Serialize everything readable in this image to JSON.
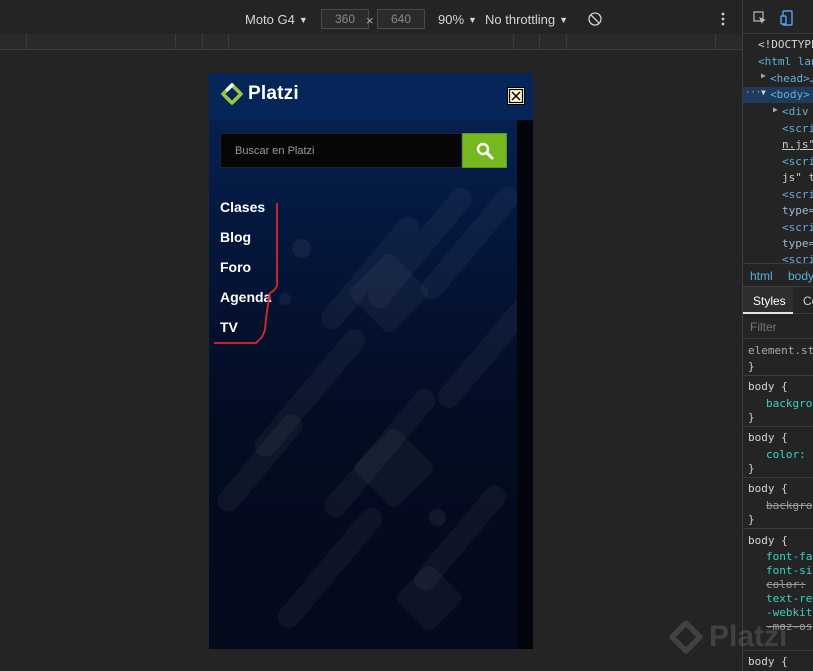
{
  "toolbar": {
    "device": "Moto G4",
    "width": "360",
    "times": "×",
    "height": "640",
    "zoom": "90%",
    "throttling": "No throttling"
  },
  "page": {
    "logo_text": "Platzi",
    "search_placeholder": "Buscar en Platzi",
    "nav": [
      "Clases",
      "Blog",
      "Foro",
      "Agenda",
      "TV"
    ]
  },
  "devtools": {
    "elements": [
      "<!DOCTYPE",
      "<html lan",
      "<head>…",
      "<body>",
      "<div",
      "<scri",
      "n.js\"",
      "<scri",
      "js\" t",
      "<scri",
      "type=",
      "<scri",
      "type=",
      "<scri"
    ],
    "breadcrumb": [
      "html",
      "body"
    ],
    "tabs": [
      "Styles",
      "Co"
    ],
    "filter_placeholder": "Filter",
    "styles": {
      "element_style": "element.st",
      "close_brace": "}",
      "rules": [
        {
          "selector": "body {",
          "props": [
            "backgro"
          ]
        },
        {
          "selector": "body {",
          "props": [
            "color:"
          ]
        },
        {
          "selector": "body {",
          "props": [
            "backgro"
          ]
        },
        {
          "selector": "body {",
          "props": [
            "font-fam",
            "font-si",
            "color:",
            "text-re",
            "-webkit",
            "-moz-os"
          ]
        },
        {
          "selector": "body {",
          "props": []
        }
      ]
    },
    "watermark": "Platzi"
  },
  "colors": {
    "accent_green": "#78b81f",
    "annotation_red": "#e0262b"
  }
}
